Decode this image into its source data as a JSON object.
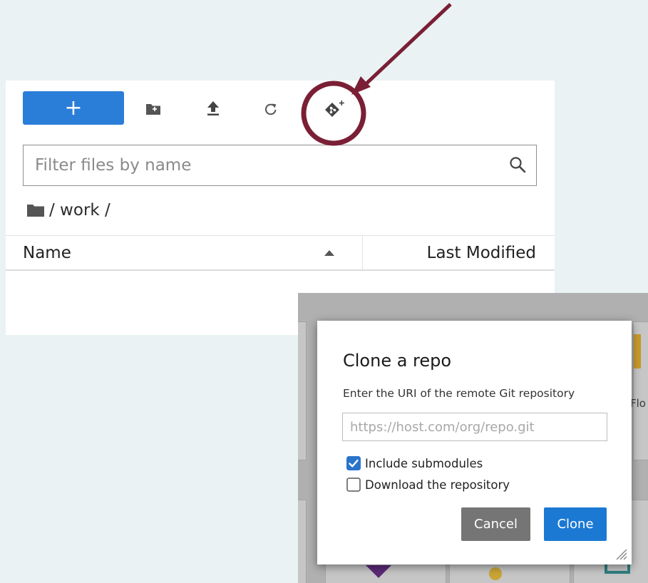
{
  "toolbar": {
    "new_label": "+",
    "icons": [
      "new-folder-icon",
      "upload-icon",
      "refresh-icon",
      "git-clone-icon"
    ]
  },
  "search": {
    "placeholder": "Filter files by name"
  },
  "breadcrumb": {
    "path": "/ work /"
  },
  "file_list": {
    "columns": [
      "Name",
      "Last Modified"
    ],
    "rows": []
  },
  "background_app": {
    "partial_label": "Flo"
  },
  "dialog": {
    "title": "Clone a repo",
    "prompt": "Enter the URI of the remote Git repository",
    "uri_placeholder": "https://host.com/org/repo.git",
    "uri_value": "",
    "options": [
      {
        "label": "Include submodules",
        "checked": true
      },
      {
        "label": "Download the repository",
        "checked": false
      }
    ],
    "cancel_label": "Cancel",
    "clone_label": "Clone"
  },
  "colors": {
    "page_background": "#eaf2f4",
    "primary_button": "#2a7ed8",
    "clone_button": "#1b79d3",
    "cancel_button": "#757575",
    "annotation": "#7a1f35"
  }
}
